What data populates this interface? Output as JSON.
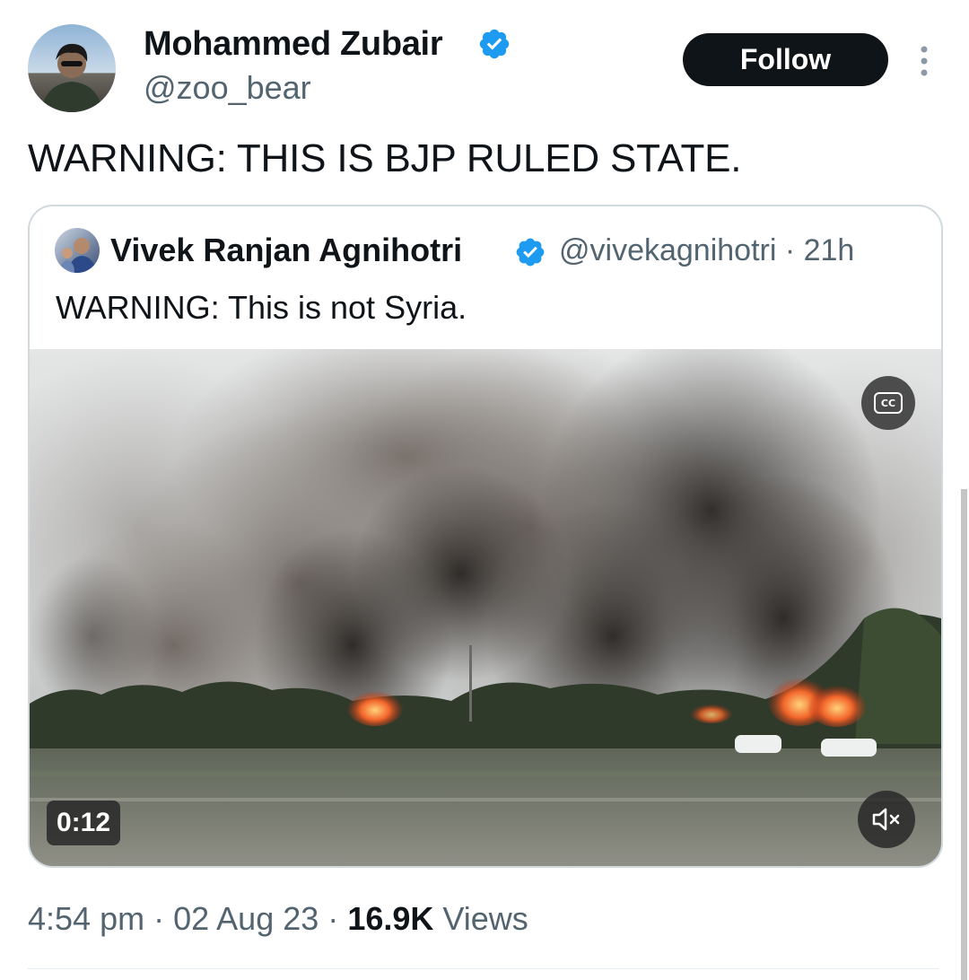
{
  "tweet": {
    "author_name": "Mohammed Zubair",
    "author_handle": "@zoo_bear",
    "follow_label": "Follow",
    "text": "WARNING: THIS IS BJP RULED STATE.",
    "time": "4:54 pm",
    "date": "02 Aug 23",
    "views_count": "16.9K",
    "views_label": "Views",
    "separator": "·"
  },
  "quote": {
    "author_name": "Vivek Ranjan Agnihotri",
    "author_handle": "@vivekagnihotri · 21h",
    "text": "WARNING: This is not Syria.",
    "video": {
      "timer": "0:12",
      "cc_label": "CC",
      "caption_icon": "closed-captions-icon",
      "mute_icon": "speaker-muted-icon"
    }
  },
  "colors": {
    "text": "#0f1419",
    "secondary": "#536471",
    "verified": "#1d9bf0",
    "border": "#cfd9de",
    "button": "#0f1419"
  }
}
